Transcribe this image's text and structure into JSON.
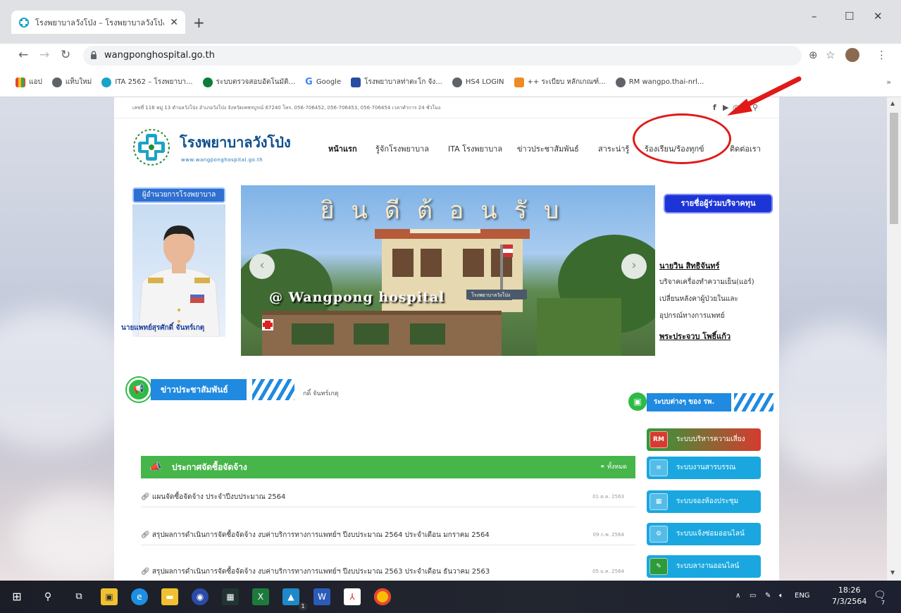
{
  "tab": {
    "title": "โรงพยาบาลวังโป่ง – โรงพยาบาลวังโป่ง",
    "close": "✕",
    "new_tab": "+"
  },
  "window": {
    "minimize": "–",
    "maximize": "☐",
    "close": "✕"
  },
  "address": {
    "url": "wangponghospital.go.th"
  },
  "bookmarks": [
    {
      "label": "แอป",
      "color": "#f4b400"
    },
    {
      "label": "แท็บใหม่",
      "color": "#5f6368"
    },
    {
      "label": "ITA 2562 – โรงพยาบา...",
      "color": "#1aa3c8"
    },
    {
      "label": "ระบบตรวจสอบอัตโนมัติ...",
      "color": "#0b7d3b"
    },
    {
      "label": "Google",
      "color": "#4285f4"
    },
    {
      "label": "โรงพยาบาลท่าตะโก จัง...",
      "color": "#2b4ca3"
    },
    {
      "label": "HS4 LOGIN",
      "color": "#5f6368"
    },
    {
      "label": "++ ระเบียบ หลักเกณฑ์...",
      "color": "#f08a24"
    },
    {
      "label": "RM wangpo.thai-nrl...",
      "color": "#5f6368"
    }
  ],
  "site": {
    "topbar_text": "เลขที่ 116 หมู่ 13 ตำบลวังโป่ง อำเภอวังโป่ง จังหวัดเพชรบูรณ์ 67240 โทร. 056-706452, 056-706453, 056-706454 เวลาทำการ 24 ชั่วโมง",
    "social": [
      "f",
      "▶",
      "◎",
      "✕",
      "⚲"
    ],
    "name": "โรงพยาบาลวังโป่ง",
    "url": "www.wangponghospital.go.th"
  },
  "nav": [
    "หน้าแรก",
    "รู้จักโรงพยาบาล",
    "ITA โรงพยาบาล",
    "ข่าวประชาสัมพันธ์",
    "สาระน่ารู้",
    "ร้องเรียน/ร้องทุกข์",
    "ติดต่อเรา"
  ],
  "director": {
    "label": "ผู้อำนวยการโรงพยาบาล",
    "name": "นายแพทย์สุรศักดิ์ จันทร์เกตุ"
  },
  "banner": {
    "welcome": "ยินดีต้อนรับ",
    "caption": "@ Wangpong hospital",
    "sign": "โรงพยาบาลวังโป่ง"
  },
  "donors": {
    "button": "รายชื่อผู้ร่วมบริจาคทุน",
    "first_name": "นายวิน สิทธิจันทร์",
    "lines": [
      "บริจาคเครื่องทำความเย็น(แอร์)",
      "เปลี่ยนหลังคาผู้ป่วยในและ",
      "อุปกรณ์ทางการแพทย์"
    ],
    "second_name": "พระประจวบ โพธิ์แก้ว"
  },
  "news": {
    "title": "ข่าวประชาสัมพันธ์",
    "ticker": "กดิ์ จันทร์เกตุ"
  },
  "procurement": {
    "title": "ประกาศจัดซื้อจัดจ้าง",
    "all_label": "ทั้งหมด",
    "items": [
      {
        "title": "แผนจัดซื้อจัดจ้าง ประจำปีงบประมาณ 2564",
        "date": "01 ต.ค. 2563"
      },
      {
        "title": "สรุปผลการดำเนินการจัดซื้อจัดจ้าง งบค่าบริการทางการแพทย์ฯ ปีงบประมาณ 2564 ประจำเดือน มกราคม 2564",
        "date": "09 ก.พ. 2564"
      },
      {
        "title": "สรุปผลการดำเนินการจัดซื้อจัดจ้าง งบค่าบริการทางการแพทย์ฯ ปีงบประมาณ 2563 ประจำเดือน ธันวาคม 2563",
        "date": "05 ม.ค. 2564"
      }
    ]
  },
  "systems": {
    "title": "ระบบต่างๆ ของ รพ.",
    "items": [
      {
        "label": "ระบบบริหารความเสี่ยง",
        "icon": "RM",
        "color": "#2e9b3a"
      },
      {
        "label": "ระบบงานสารบรรณ",
        "icon": "≡",
        "color": "#1aa7e0"
      },
      {
        "label": "ระบบจองห้องประชุม",
        "icon": "▦",
        "color": "#1aa7e0"
      },
      {
        "label": "ระบบแจ้งซ่อมออนไลน์",
        "icon": "⚙",
        "color": "#1aa7e0"
      },
      {
        "label": "ระบบลางานออนไลน์",
        "icon": "✎",
        "color": "#1aa7e0"
      }
    ]
  },
  "taskbar": {
    "lang": "ENG",
    "time": "18:26",
    "date": "7/3/2564",
    "notif": "7",
    "badge": "1"
  }
}
